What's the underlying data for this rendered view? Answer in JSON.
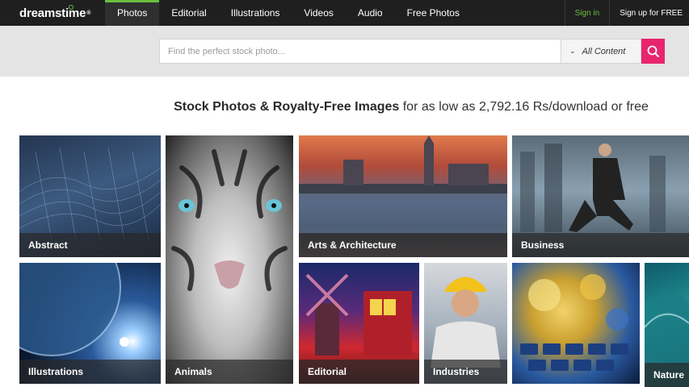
{
  "header": {
    "logo_text": "dreamstime",
    "logo_mark": "®",
    "nav": [
      "Photos",
      "Editorial",
      "Illustrations",
      "Videos",
      "Audio",
      "Free Photos"
    ],
    "active_index": 0,
    "sign_in": "Sign in",
    "sign_up": "Sign up for FREE"
  },
  "search": {
    "placeholder": "Find the perfect stock photo...",
    "scope_label": "All Content",
    "button_icon": "search-icon"
  },
  "headline": {
    "bold": "Stock Photos & Royalty-Free Images",
    "rest": " for as low as 2,792.16 Rs/download or free"
  },
  "categories": {
    "abstract": "Abstract",
    "animals": "Animals",
    "arts": "Arts & Architecture",
    "business": "Business",
    "illustrations": "Illustrations",
    "editorial": "Editorial",
    "industries": "Industries",
    "nature": "Nature"
  },
  "colors": {
    "accent_green": "#6abf3f",
    "search_pink": "#e8246f",
    "topbar": "#1f1f1f"
  }
}
